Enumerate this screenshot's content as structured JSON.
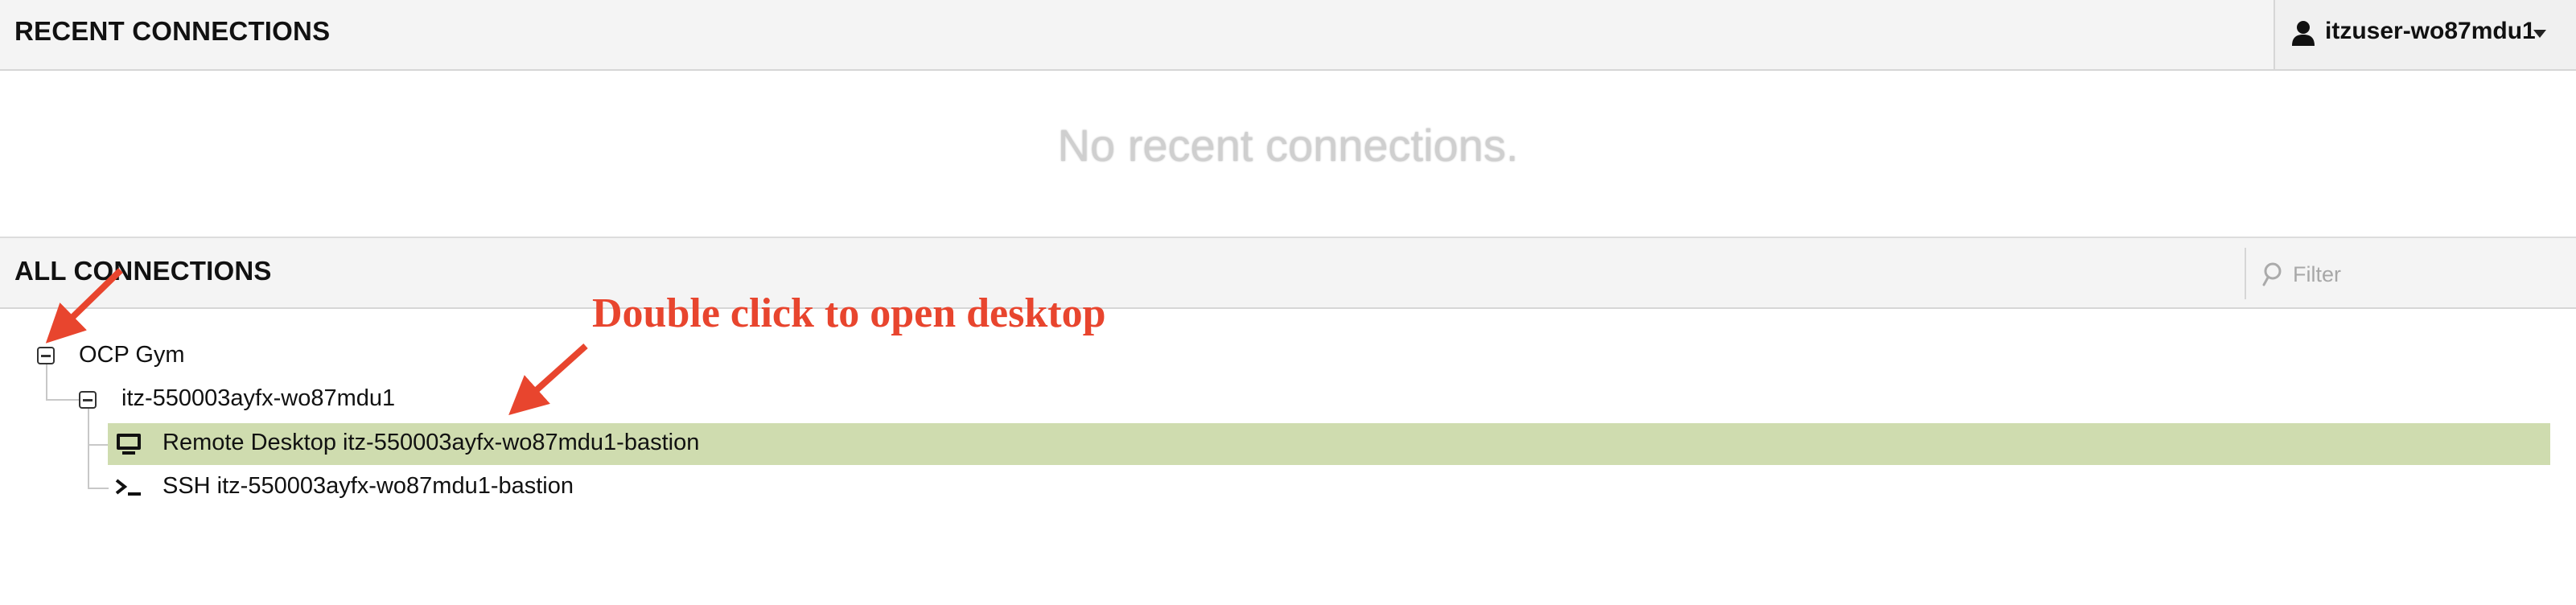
{
  "recent": {
    "title": "RECENT CONNECTIONS",
    "empty_message": "No recent connections."
  },
  "user_menu": {
    "username": "itzuser-wo87mdu1",
    "icon": "user-icon"
  },
  "all": {
    "title": "ALL CONNECTIONS",
    "filter_placeholder": "Filter",
    "filter_value": ""
  },
  "tree": {
    "group": {
      "label": "OCP Gym",
      "expanded": true,
      "subgroup": {
        "label": "itz-550003ayfx-wo87mdu1",
        "expanded": true,
        "connections": [
          {
            "label": "Remote Desktop itz-550003ayfx-wo87mdu1-bastion",
            "icon": "desktop-icon",
            "selected": true
          },
          {
            "label": "SSH itz-550003ayfx-wo87mdu1-bastion",
            "icon": "terminal-icon",
            "selected": false
          }
        ]
      }
    }
  },
  "annotation": {
    "text": "Double click to open desktop",
    "color": "#e8452e"
  },
  "colors": {
    "header_bg": "#f4f4f4",
    "selected_row": "#cfdcaf"
  }
}
